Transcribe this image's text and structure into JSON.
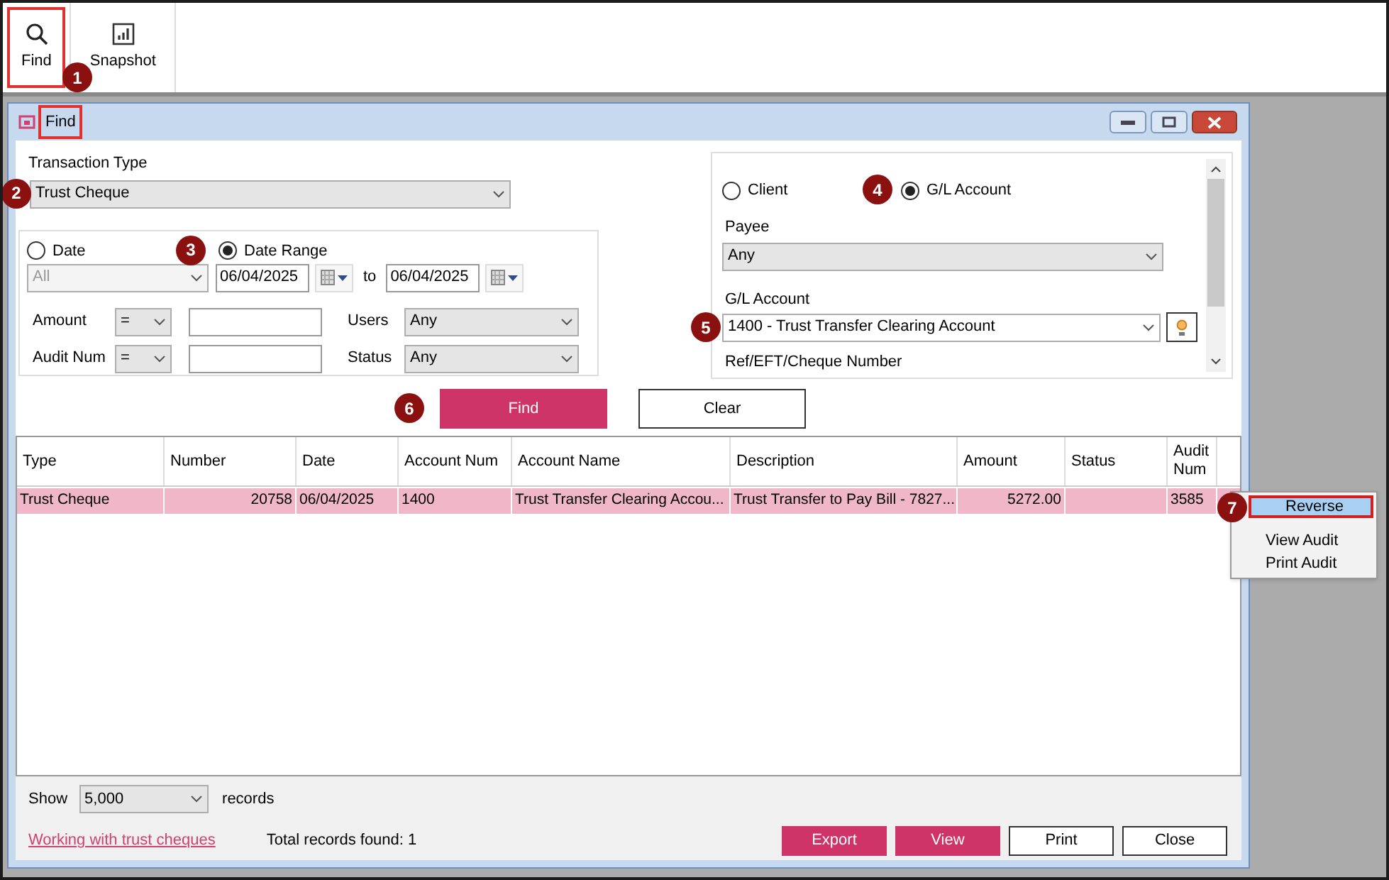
{
  "toolbar": [
    {
      "label": "Find",
      "highlighted": true,
      "callout": "1"
    },
    {
      "label": "Snapshot",
      "highlighted": false
    }
  ],
  "window": {
    "title": "Find",
    "title_highlighted": true
  },
  "transaction_type": {
    "label": "Transaction Type",
    "value": "Trust Cheque",
    "callout": "2"
  },
  "date_mode": [
    {
      "label": "Date",
      "selected": false
    },
    {
      "label": "Date Range",
      "selected": true,
      "callout": "3"
    }
  ],
  "date_select": {
    "value": "All",
    "disabled": true
  },
  "date_from": "06/04/2025",
  "to_label": "to",
  "date_to": "06/04/2025",
  "filters": [
    {
      "label": "Amount",
      "operator": "="
    },
    {
      "label": "Audit Num",
      "operator": "="
    }
  ],
  "right_filters": [
    {
      "label": "Users",
      "value": "Any"
    },
    {
      "label": "Status",
      "value": "Any"
    }
  ],
  "payee_type": [
    {
      "label": "Client",
      "selected": false
    },
    {
      "label": "G/L Account",
      "selected": true,
      "callout": "4"
    }
  ],
  "payee": {
    "label": "Payee",
    "value": "Any"
  },
  "gl_account": {
    "label": "G/L Account",
    "value": "1400 - Trust Transfer Clearing Account",
    "callout": "5"
  },
  "ref_label": "Ref/EFT/Cheque Number",
  "actions": [
    {
      "label": "Find",
      "kind": "primary",
      "callout": "6"
    },
    {
      "label": "Clear",
      "kind": "secondary"
    }
  ],
  "table": {
    "columns": [
      "Type",
      "Number",
      "Date",
      "Account Num",
      "Account Name",
      "Description",
      "Amount",
      "Status",
      "Audit Num"
    ],
    "rows": [
      {
        "selected": true,
        "cells": [
          "Trust Cheque",
          "20758",
          "06/04/2025",
          "1400",
          "Trust Transfer Clearing Accou...",
          "Trust Transfer to Pay Bill - 7827...",
          "5272.00",
          "",
          "3585"
        ]
      }
    ]
  },
  "context_menu": [
    {
      "label": "Reverse",
      "selected": true,
      "callout": "7"
    },
    {
      "label": "View Audit",
      "selected": false
    },
    {
      "label": "Print Audit",
      "selected": false
    }
  ],
  "footer": {
    "show_label": "Show",
    "show_value": "5,000",
    "records_label": "records",
    "help_link": "Working with trust cheques",
    "total": "Total records found: 1",
    "buttons": [
      {
        "label": "Export",
        "kind": "primary"
      },
      {
        "label": "View",
        "kind": "primary"
      },
      {
        "label": "Print",
        "kind": "secondary"
      },
      {
        "label": "Close",
        "kind": "secondary"
      }
    ]
  }
}
